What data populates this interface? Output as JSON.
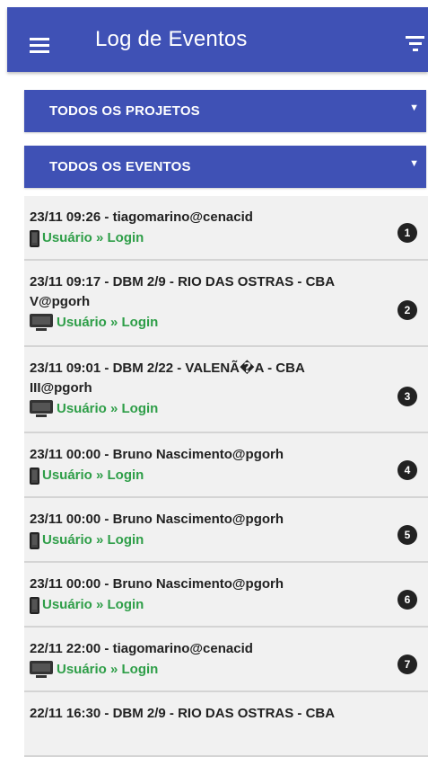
{
  "header": {
    "title": "Log de Eventos",
    "menu_icon": "menu-icon",
    "filter_icon": "filter-icon"
  },
  "filters": {
    "projects_label": "TODOS OS PROJETOS",
    "events_label": "TODOS OS EVENTOS",
    "caret": "▼"
  },
  "colors": {
    "primary": "#3f51b5",
    "action_green": "#2e9e48",
    "item_bg": "#f1f1f1"
  },
  "events": [
    {
      "line1": "23/11 09:26 - tiagomarino@cenacid",
      "line2": "",
      "device": "phone",
      "action": "Usuário » Login",
      "index": "1"
    },
    {
      "line1": "23/11 09:17 - DBM 2/9 - RIO DAS OSTRAS - CBA",
      "line2": "V@pgorh",
      "device": "desktop",
      "action": "Usuário » Login",
      "index": "2"
    },
    {
      "line1": "23/11 09:01 - DBM 2/22 - VALENÃ�A - CBA",
      "line2": "III@pgorh",
      "device": "desktop",
      "action": "Usuário » Login",
      "index": "3"
    },
    {
      "line1": "23/11 00:00 - Bruno Nascimento@pgorh",
      "line2": "",
      "device": "phone",
      "action": "Usuário » Login",
      "index": "4"
    },
    {
      "line1": "23/11 00:00 - Bruno Nascimento@pgorh",
      "line2": "",
      "device": "phone",
      "action": "Usuário » Login",
      "index": "5"
    },
    {
      "line1": "23/11 00:00 - Bruno Nascimento@pgorh",
      "line2": "",
      "device": "phone",
      "action": "Usuário » Login",
      "index": "6"
    },
    {
      "line1": "22/11 22:00 - tiagomarino@cenacid",
      "line2": "",
      "device": "desktop",
      "action": "Usuário » Login",
      "index": "7"
    },
    {
      "line1": "22/11 16:30 - DBM 2/9 - RIO DAS OSTRAS - CBA",
      "line2": "",
      "device": "desktop",
      "action": "",
      "index": ""
    }
  ]
}
